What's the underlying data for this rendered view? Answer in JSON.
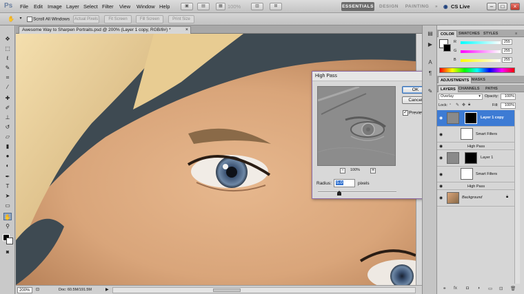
{
  "app": {
    "logo": "Ps",
    "menus": [
      "File",
      "Edit",
      "Image",
      "Layer",
      "Select",
      "Filter",
      "View",
      "Window",
      "Help"
    ],
    "zoom_readout": "100%",
    "workspaces": [
      "ESSENTIALS",
      "DESIGN",
      "PAINTING"
    ],
    "workspace_more": "»",
    "cs_live": "CS Live"
  },
  "options_bar": {
    "scroll_all_windows": "Scroll All Windows",
    "actual_pixels": "Actual Pixels",
    "fit_screen": "Fit Screen",
    "fill_screen": "Fill Screen",
    "print_size": "Print Size"
  },
  "document": {
    "tab_title": "Awesome Way to Sharpen Portraits.psd @ 200% (Layer 1 copy, RGB/8#) *",
    "zoom": "200%",
    "doc_info": "Doc: 60.5M/191.5M"
  },
  "high_pass_dialog": {
    "title": "High Pass",
    "ok": "OK",
    "cancel": "Cancel",
    "preview_label": "Preview",
    "preview_checked": true,
    "zoom_minus": "-",
    "zoom_value": "100%",
    "zoom_plus": "+",
    "radius_label": "Radius:",
    "radius_value": "5.0",
    "radius_unit": "pixels"
  },
  "color_panel": {
    "tabs": [
      "COLOR",
      "SWATCHES",
      "STYLES"
    ],
    "channels": [
      {
        "label": "R",
        "value": "255",
        "color": "#ff4040"
      },
      {
        "label": "G",
        "value": "255",
        "color": "#40c040"
      },
      {
        "label": "B",
        "value": "255",
        "color": "#4060ff"
      }
    ]
  },
  "adjustments_panel": {
    "tabs": [
      "ADJUSTMENTS",
      "MASKS"
    ]
  },
  "layers_panel": {
    "tabs": [
      "LAYERS",
      "CHANNELS",
      "PATHS"
    ],
    "blend_mode": "Overlay",
    "opacity_label": "Opacity:",
    "opacity_value": "100%",
    "lock_label": "Lock:",
    "fill_label": "Fill:",
    "fill_value": "100%",
    "layers": [
      {
        "name": "Layer 1 copy",
        "selected": true
      },
      {
        "smart_filters": "Smart Filters",
        "filter": "High Pass"
      },
      {
        "name": "Layer 1",
        "selected": false
      },
      {
        "smart_filters": "Smart Filters",
        "filter": "High Pass"
      },
      {
        "name": "Background",
        "selected": false
      }
    ]
  },
  "colors": {
    "selection_blue": "#3d7bd4",
    "dialog_border": "#8c6aa5",
    "workspace_active": "#6c6c6c"
  }
}
